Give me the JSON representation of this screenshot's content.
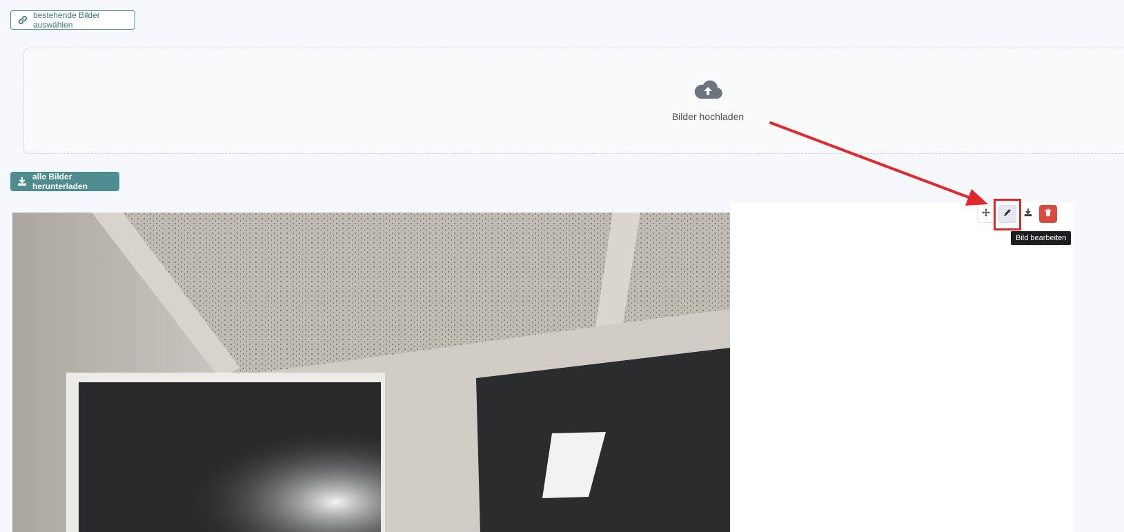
{
  "toolbar": {
    "select_existing_label": "bestehende Bilder auswählen",
    "download_all_label": "alle Bilder herunterladen"
  },
  "upload": {
    "label": "Bilder hochladen",
    "icon": "cloud-upload-icon"
  },
  "image_actions": {
    "move_icon": "move-icon",
    "edit_icon": "pencil-icon",
    "download_icon": "download-icon",
    "delete_icon": "trash-icon",
    "tooltip": "Bild bearbeiten"
  },
  "colors": {
    "accent": "#4f8c8f",
    "danger": "#d94b3e",
    "annotation": "#e0282c",
    "background": "#f7f8fb"
  }
}
